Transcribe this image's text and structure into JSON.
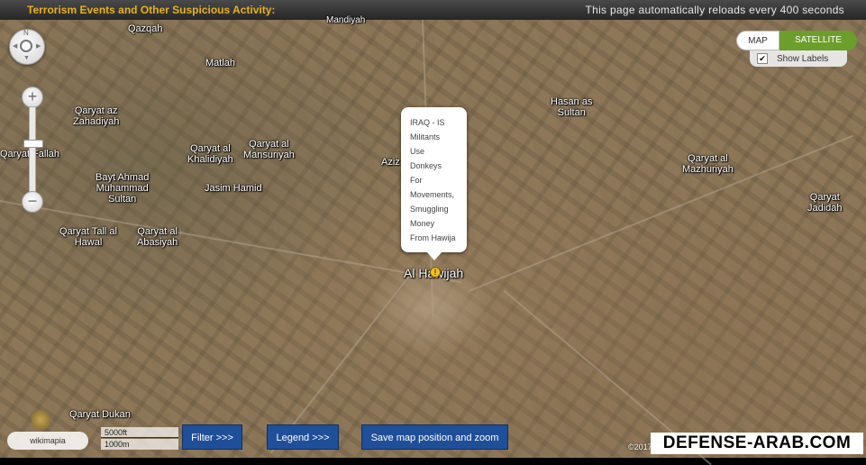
{
  "header": {
    "title": "Terrorism Events and Other Suspicious Activity:",
    "reload_notice": "This page automatically reloads every 400 seconds"
  },
  "map": {
    "type_control": {
      "map_label": "MAP",
      "satellite_label": "SATELLITE",
      "selected": "SATELLITE"
    },
    "show_labels": {
      "label": "Show Labels",
      "checked": true
    },
    "nav": {
      "north_label": "N",
      "zoom_in": "+",
      "zoom_out": "−"
    },
    "places": [
      {
        "name": "Qazqah"
      },
      {
        "name": "Matlah"
      },
      {
        "name": "Qaryat az\nZahadiyah"
      },
      {
        "name": "Qaryat Fallah"
      },
      {
        "name": "Qaryat al\nKhalidiyah"
      },
      {
        "name": "Qaryat al\nMansuriyah"
      },
      {
        "name": "Bayt Ahmad\nMuhammad\nSultan"
      },
      {
        "name": "Jasim Hamid"
      },
      {
        "name": "Qaryat Tall al\nHawal"
      },
      {
        "name": "Qaryat al\nAbasiyah"
      },
      {
        "name": "Hasan as\nSultan"
      },
      {
        "name": "Qaryat al\nMazhuriyah"
      },
      {
        "name": "Qaryat\nJadidah"
      },
      {
        "name": "Qaryat Dukan"
      },
      {
        "name": "Aziz"
      },
      {
        "name": "Mandiyah"
      }
    ],
    "city_label": "Al Hawijah",
    "popup_lines": [
      "IRAQ - IS",
      "Militants",
      "Use",
      "Donkeys",
      "For",
      "Movements,",
      "Smuggling",
      "Money",
      "From Hawija"
    ],
    "marker_symbol": "!",
    "scale": {
      "imperial": "5000ft",
      "metric": "1000m"
    },
    "logo_text": "wikimapia",
    "copyright": "©2017"
  },
  "buttons": {
    "filter": "Filter >>>",
    "legend": "Legend >>>",
    "save": "Save map position and zoom"
  },
  "watermark": "DEFENSE-ARAB.COM",
  "colors": {
    "title": "#e8b21c",
    "button": "#1f4f99",
    "satellite_active": "#6c9e2b"
  }
}
